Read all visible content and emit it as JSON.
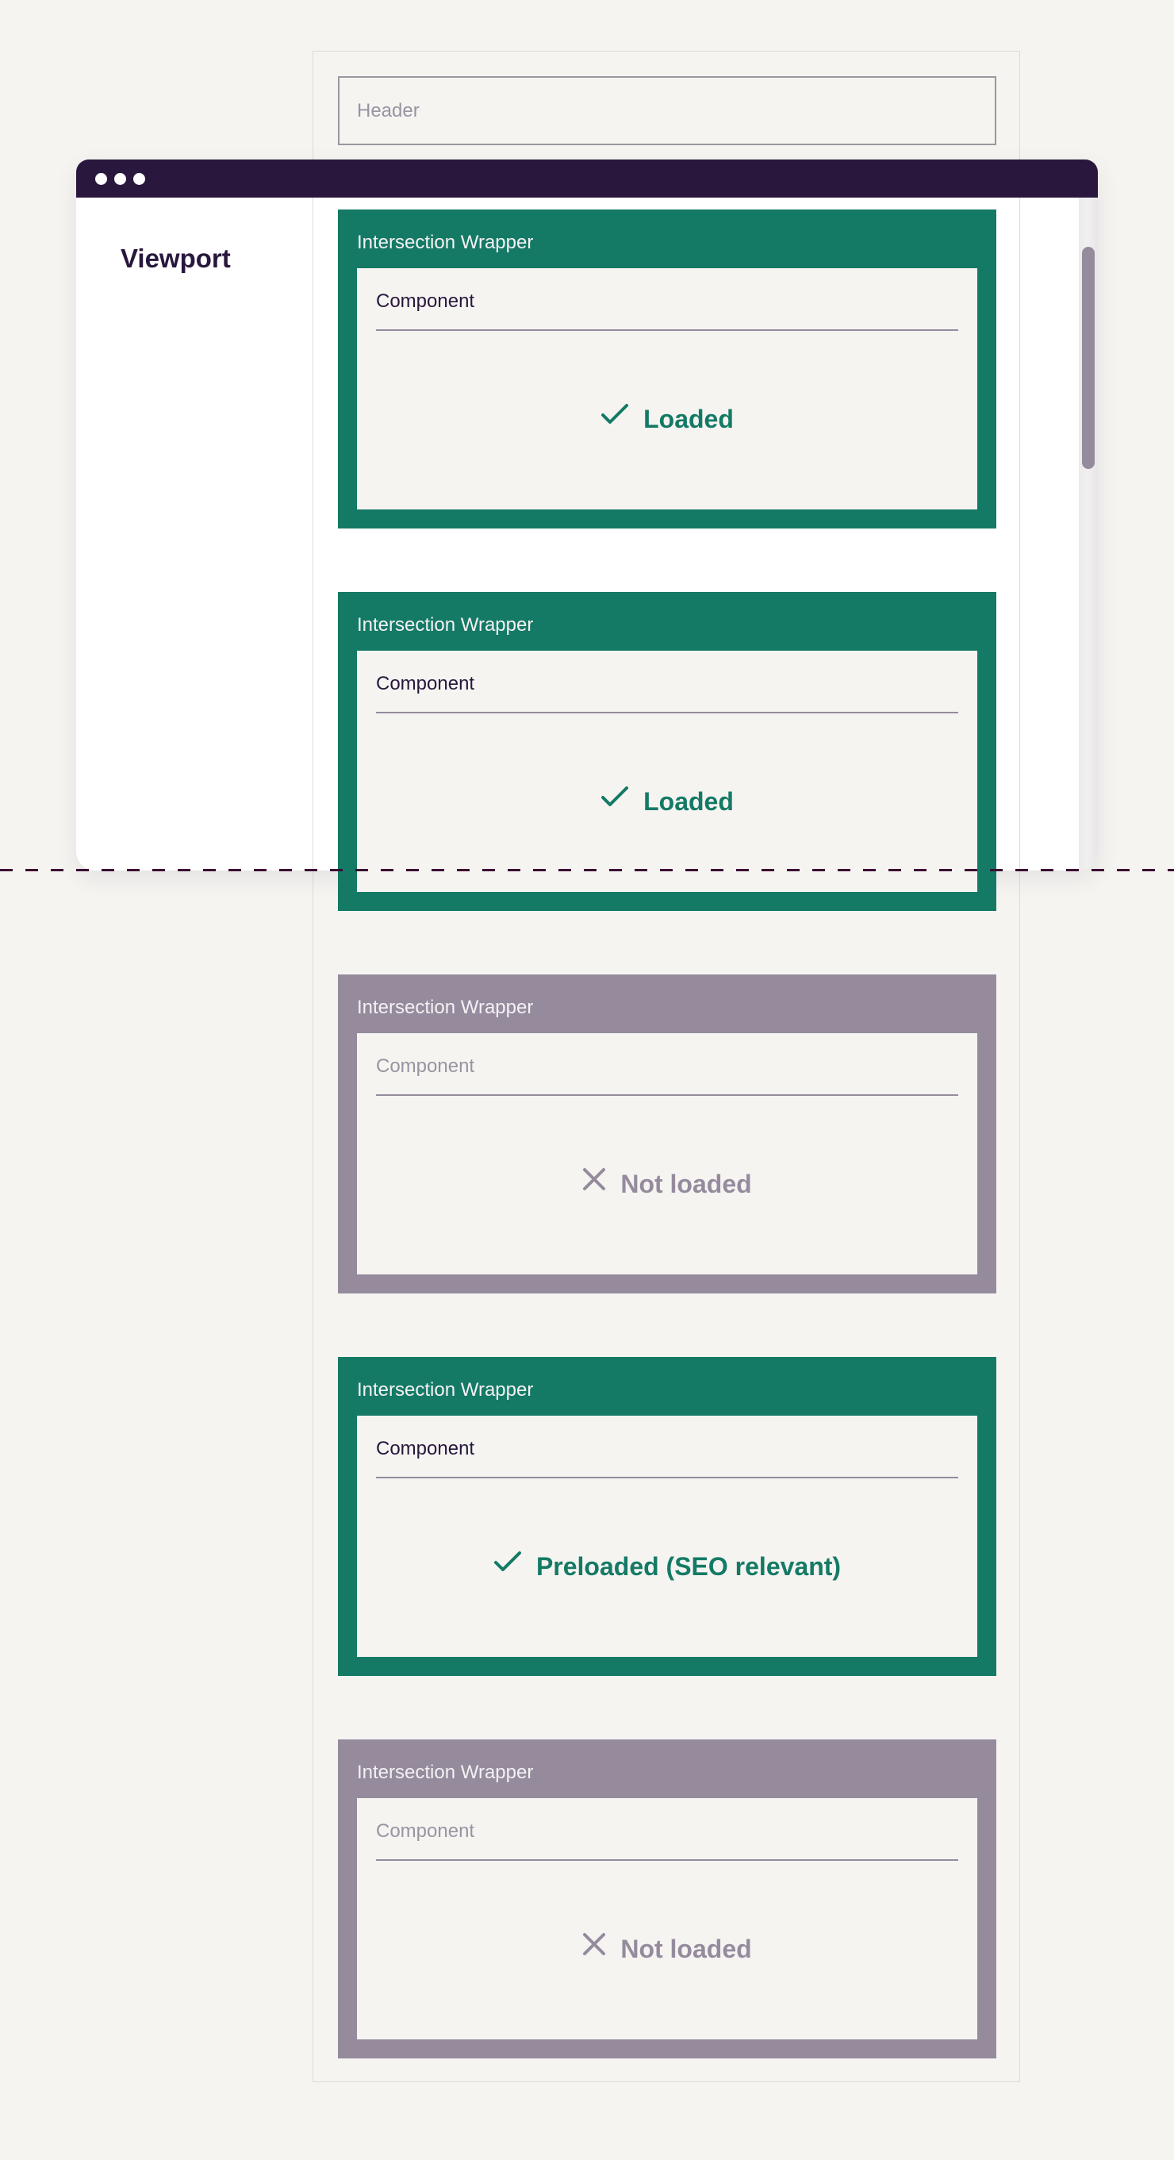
{
  "header": {
    "label": "Header"
  },
  "viewport": {
    "label": "Viewport",
    "window_dots": 3,
    "scroll_position_fraction": 0.07
  },
  "colors": {
    "loaded": "#147a65",
    "not_loaded": "#958b9d",
    "window_bar": "#29173d",
    "fold_line": "#3b0d33",
    "background": "#f5f4f1"
  },
  "wrappers": [
    {
      "label": "Intersection Wrapper",
      "component": "Component",
      "state": "loaded",
      "icon": "check-icon",
      "status": "Loaded"
    },
    {
      "label": "Intersection Wrapper",
      "component": "Component",
      "state": "loaded",
      "icon": "check-icon",
      "status": "Loaded"
    },
    {
      "label": "Intersection Wrapper",
      "component": "Component",
      "state": "unloaded",
      "icon": "x-icon",
      "status": "Not loaded"
    },
    {
      "label": "Intersection Wrapper",
      "component": "Component",
      "state": "loaded",
      "icon": "check-icon",
      "status": "Preloaded (SEO relevant)"
    },
    {
      "label": "Intersection Wrapper",
      "component": "Component",
      "state": "unloaded",
      "icon": "x-icon",
      "status": "Not loaded"
    }
  ]
}
